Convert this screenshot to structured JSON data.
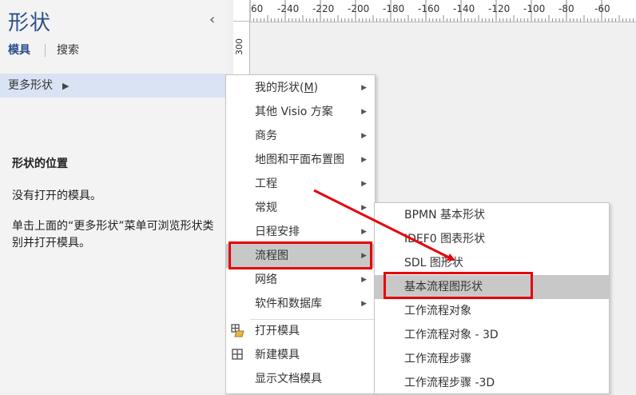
{
  "pane": {
    "title": "形状",
    "collapse_glyph": "‹",
    "tab_stencils": "模具",
    "tab_search": "搜索",
    "more_shapes_label": "更多形状",
    "more_shapes_arrow": "▶",
    "info_heading": "形状的位置",
    "info_line1": "没有打开的模具。",
    "info_line2": "单击上面的“更多形状”菜单可浏览形状类别并打开模具。"
  },
  "ruler": {
    "top_labels": [
      "60",
      "-240",
      "-220",
      "-200",
      "-180",
      "-160",
      "-140",
      "-120",
      "-100",
      "-80",
      "-60"
    ],
    "left_label": "300"
  },
  "menu1": {
    "items": [
      {
        "label": "我的形状(",
        "mnemonic": "M",
        "suffix": ")",
        "has_submenu": true
      },
      {
        "label": "其他 Visio 方案",
        "has_submenu": true
      },
      {
        "label": "商务",
        "has_submenu": true
      },
      {
        "label": "地图和平面布置图",
        "has_submenu": true
      },
      {
        "label": "工程",
        "has_submenu": true
      },
      {
        "label": "常规",
        "has_submenu": true
      },
      {
        "label": "日程安排",
        "has_submenu": true
      },
      {
        "label": "流程图",
        "has_submenu": true,
        "highlighted": true
      },
      {
        "label": "网络",
        "has_submenu": true
      },
      {
        "label": "软件和数据库",
        "has_submenu": true
      },
      {
        "label": "打开模具",
        "icon": "open-stencil-icon"
      },
      {
        "label": "新建模具",
        "icon": "new-stencil-icon"
      },
      {
        "label": "显示文档模具"
      }
    ],
    "submenu_glyph": "▶"
  },
  "menu2": {
    "items": [
      {
        "label": "BPMN 基本形状"
      },
      {
        "label": "IDEF0 图表形状"
      },
      {
        "label": "SDL 图形状"
      },
      {
        "label": "基本流程图形状",
        "highlighted": true
      },
      {
        "label": "工作流程对象"
      },
      {
        "label": "工作流程对象 - 3D"
      },
      {
        "label": "工作流程步骤"
      },
      {
        "label": "工作流程步骤 -3D"
      }
    ]
  },
  "colors": {
    "accent": "#2b4f8a",
    "annotation_red": "#e8000b",
    "highlight": "#c8c8c8",
    "pane_selection": "#d9e3f4"
  },
  "icons": {
    "open_stencil": "⊞",
    "new_stencil": "⊞"
  }
}
